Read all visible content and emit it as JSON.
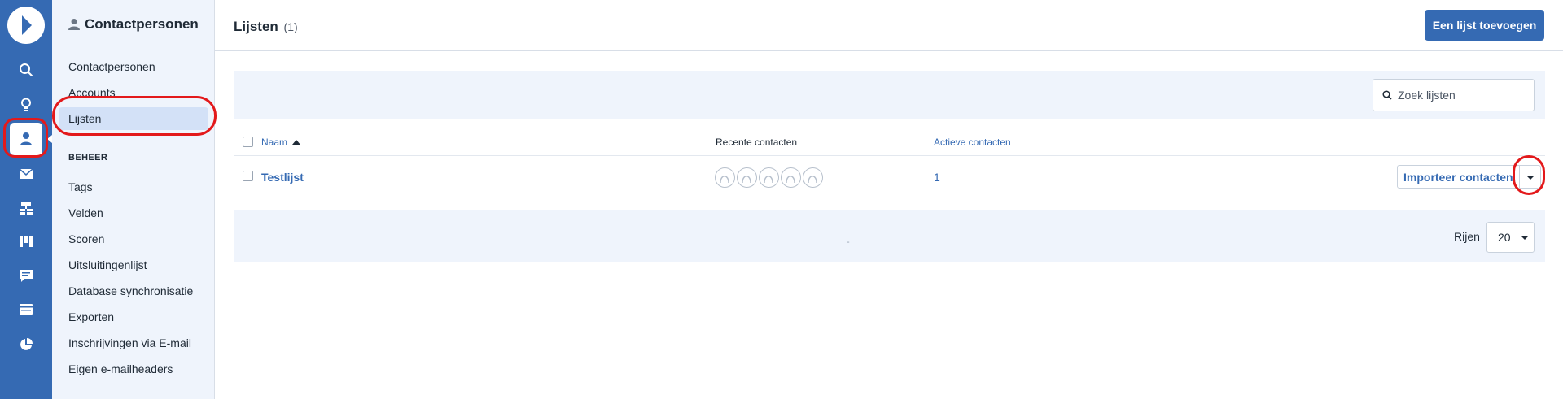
{
  "colors": {
    "accent": "#356ab3",
    "highlight_ring": "#e3191b",
    "panel_bg": "#eff4fc"
  },
  "rail": {
    "logo": "app-logo",
    "icons": [
      "search-icon",
      "lightbulb-icon",
      "contacts-icon",
      "email-icon",
      "automation-icon",
      "pipeline-icon",
      "chat-icon",
      "website-icon",
      "reports-icon"
    ],
    "active": "contacts-icon"
  },
  "sidebar": {
    "title": "Contactpersonen",
    "items": [
      {
        "label": "Contactpersonen"
      },
      {
        "label": "Accounts"
      },
      {
        "label": "Lijsten",
        "selected": true
      }
    ],
    "section_title": "BEHEER",
    "section_items": [
      {
        "label": "Tags"
      },
      {
        "label": "Velden"
      },
      {
        "label": "Scoren"
      },
      {
        "label": "Uitsluitingenlijst"
      },
      {
        "label": "Database synchronisatie"
      },
      {
        "label": "Exporten"
      },
      {
        "label": "Inschrijvingen via E-mail"
      },
      {
        "label": "Eigen e-mailheaders"
      }
    ]
  },
  "header": {
    "title": "Lijsten",
    "count": "(1)",
    "add_button": "Een lijst toevoegen"
  },
  "search": {
    "placeholder": "Zoek lijsten",
    "value": ""
  },
  "table": {
    "columns": {
      "name": "Naam",
      "recent": "Recente contacten",
      "active": "Actieve contacten"
    },
    "sort": {
      "column": "Naam",
      "direction": "ascending"
    },
    "rows": [
      {
        "name": "Testlijst",
        "recent_avatar_count": 5,
        "active": "1",
        "action_button": "Importeer contacten"
      }
    ]
  },
  "pagination": {
    "separator": "-",
    "rows_label": "Rijen",
    "rows_value": "20"
  }
}
